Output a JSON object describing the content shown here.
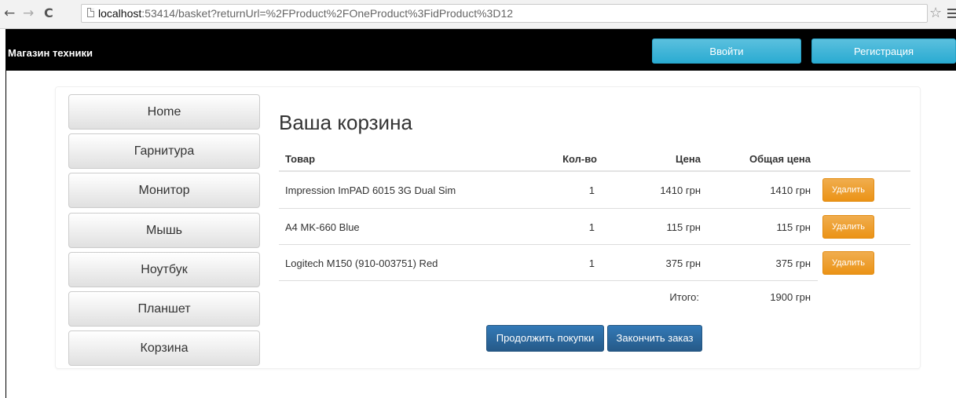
{
  "browser": {
    "back": "←",
    "forward": "→",
    "reload": "C",
    "url_host": "localhost",
    "url_rest": ":53414/basket?returnUrl=%2FProduct%2FOneProduct%3FidProduct%3D12",
    "star": "☆"
  },
  "navbar": {
    "brand": "Магазин техники",
    "login": "Ввойти",
    "register": "Регистрация"
  },
  "sidebar": {
    "items": [
      "Home",
      "Гарнитура",
      "Монитор",
      "Мышь",
      "Ноутбук",
      "Планшет",
      "Корзина"
    ]
  },
  "cart": {
    "title": "Ваша корзина",
    "headers": {
      "product": "Товар",
      "qty": "Кол-во",
      "price": "Цена",
      "total": "Общая цена"
    },
    "rows": [
      {
        "product": "Impression ImPAD 6015 3G Dual Sim",
        "qty": "1",
        "price": "1410 грн",
        "total": "1410 грн",
        "delete": "Удалить"
      },
      {
        "product": "A4 MK-660 Blue",
        "qty": "1",
        "price": "115 грн",
        "total": "115 грн",
        "delete": "Удалить"
      },
      {
        "product": "Logitech M150 (910-003751) Red",
        "qty": "1",
        "price": "375 грн",
        "total": "375 грн",
        "delete": "Удалить"
      }
    ],
    "summary_label": "Итого:",
    "summary_value": "1900 грн",
    "continue_button": "Продолжить покупки",
    "checkout_button": "Закончить заказ"
  },
  "colors": {
    "navbar": "#000000",
    "info": "#5bc0de",
    "warning": "#f0ad4e",
    "primary": "#337ab7"
  }
}
